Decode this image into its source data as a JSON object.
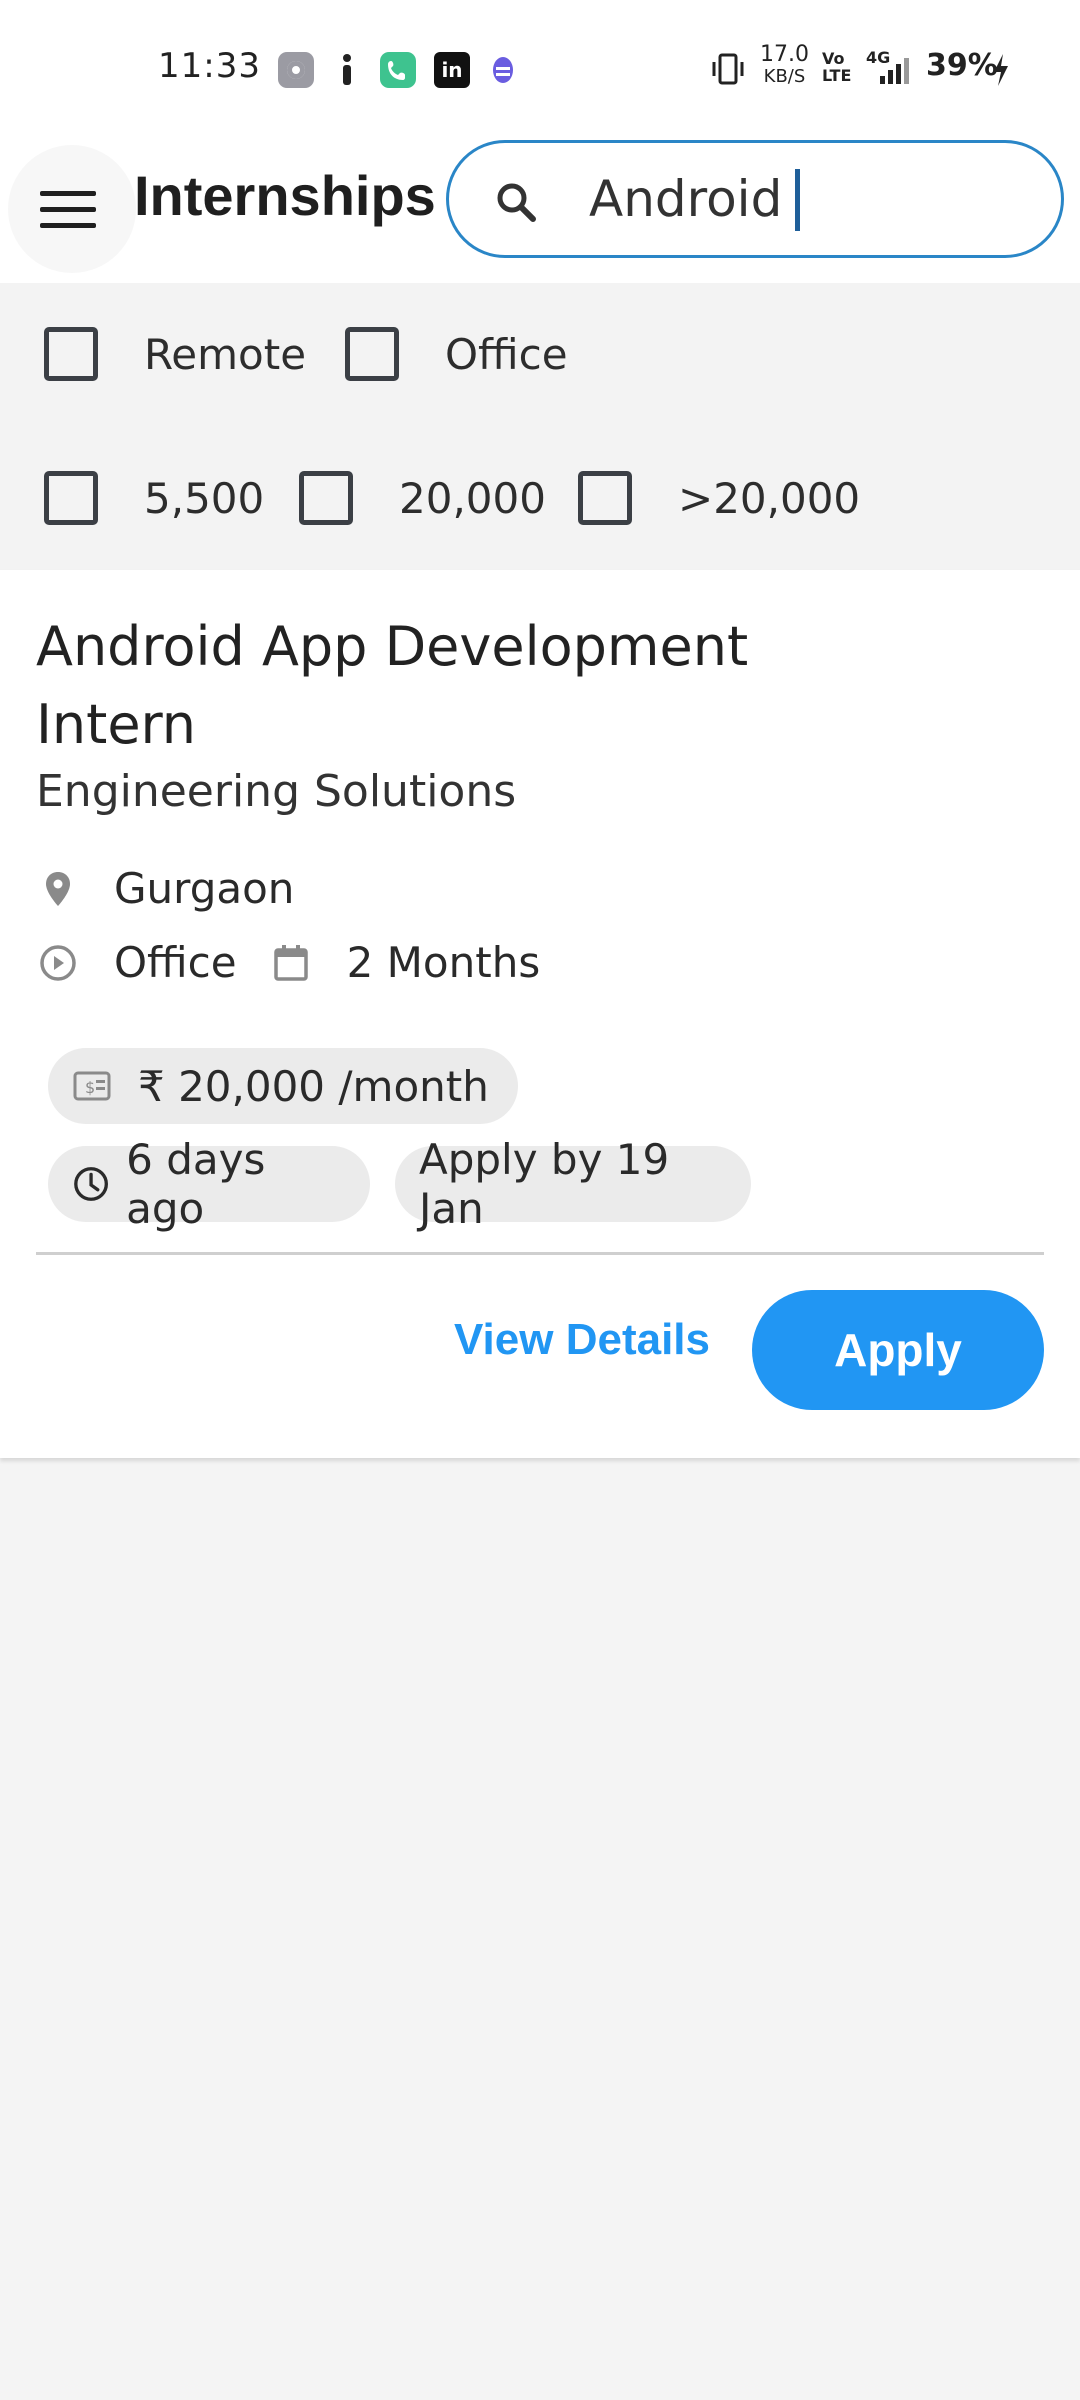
{
  "status_bar": {
    "time": "11:33",
    "net_speed_value": "17.0",
    "net_speed_unit": "KB/S",
    "volte": "Vo LTE",
    "network": "4G",
    "battery": "39%"
  },
  "app_bar": {
    "title": "Internships",
    "search": {
      "value": "Android",
      "placeholder": ""
    }
  },
  "filters": {
    "work_type": [
      {
        "label": "Remote",
        "checked": false
      },
      {
        "label": "Office",
        "checked": false
      }
    ],
    "stipend": [
      {
        "label": "5,500",
        "checked": false
      },
      {
        "label": "20,000",
        "checked": false
      },
      {
        "label": ">20,000",
        "checked": false
      }
    ]
  },
  "internship": {
    "title": "Android App Development Intern",
    "company": "Engineering Solutions",
    "location": "Gurgaon",
    "mode": "Office",
    "duration": "2 Months",
    "stipend": "₹ 20,000 /month",
    "posted": "6 days ago",
    "deadline": "Apply by 19 Jan",
    "view_details_label": "View Details",
    "apply_label": "Apply"
  },
  "colors": {
    "accent": "#2196f3",
    "search_border": "#2a86c7",
    "background": "#f4f4f4",
    "chip": "#ebebeb"
  },
  "icons": {
    "menu": "hamburger-menu-icon",
    "search": "search-icon",
    "location": "location-pin-icon",
    "mode": "play-circle-icon",
    "duration": "calendar-icon",
    "stipend": "money-icon",
    "posted": "clock-icon"
  }
}
